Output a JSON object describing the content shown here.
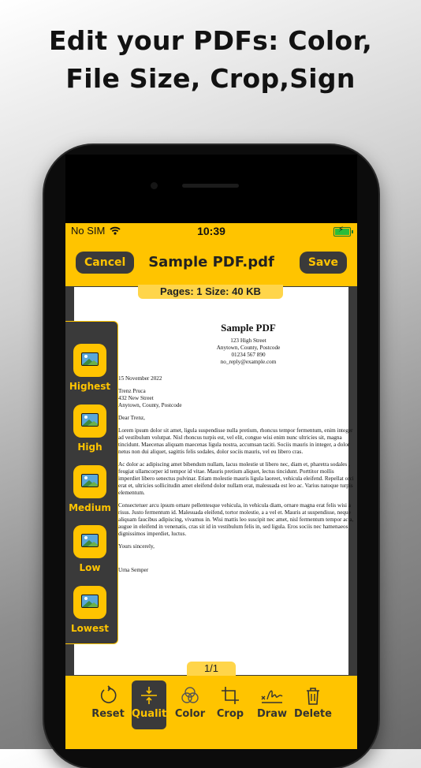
{
  "headline": {
    "line1": "Edit your PDFs: Color,",
    "line2": "File Size, Crop,Sign"
  },
  "status_bar": {
    "carrier": "No SIM",
    "time": "10:39"
  },
  "nav": {
    "cancel": "Cancel",
    "title": "Sample PDF.pdf",
    "save": "Save"
  },
  "doc_info": "Pages: 1   Size: 40 KB",
  "pdf": {
    "title": "Sample PDF",
    "address_lines": [
      "123 High Street",
      "Anytown, County, Postcode",
      "01234 567 890",
      "no_reply@example.com"
    ],
    "date": "15 November 2022",
    "recipient": [
      "Trenz Pruca",
      "432 New Street",
      "Anytown, County, Postcode"
    ],
    "salutation": "Dear Trenz,",
    "paragraphs": [
      "Lorem ipsum dolor sit amet, ligula suspendisse nulla pretium, rhoncus tempor fermentum, enim integer ad vestibulum volutpat. Nisl rhoncus turpis est, vel elit, congue wisi enim nunc ultricies sit, magna tincidunt. Maecenas aliquam maecenas ligula nostra, accumsan taciti. Sociis mauris in integer, a dolor netus non dui aliquet, sagittis felis sodales, dolor sociis mauris, vel eu libero cras.",
      "Ac dolor ac adipiscing amet bibendum nullam, lacus molestie ut libero nec, diam et, pharetra sodales , feugiat ullamcorper id tempor id vitae. Mauris pretium aliquet, lectus tincidunt. Porttitor mollis imperdiet libero senectus pulvinar. Etiam molestie mauris ligula laoreet, vehicula eleifend. Repellat orci erat et, ultricies sollicitudin amet eleifend dolor nullam erat, malesuada est leo ac. Varius natoque turpis elementum.",
      "Consectetuer arcu ipsum ornare pellentesque vehicula, in vehicula diam, ornare magna erat felis wisi a risus. Justo fermentum id. Malesuada eleifend, tortor molestie, a a vel et. Mauris at suspendisse, neque aliquam faucibus adipiscing, vivamus in. Wisi mattis leo suscipit nec amet, nisl fermentum tempor ac a, augue in eleifend in venenatis, cras sit id in vestibulum felis in, sed ligula. Eros sociis nec hamenaeos dignissimos imperdiet, luctus."
    ],
    "closing": "Yours sincerely,",
    "signature": "Urna Semper"
  },
  "quality_options": [
    {
      "label": "Highest",
      "icon": "image-icon"
    },
    {
      "label": "High",
      "icon": "image-icon"
    },
    {
      "label": "Medium",
      "icon": "image-icon"
    },
    {
      "label": "Low",
      "icon": "image-icon"
    },
    {
      "label": "Lowest",
      "icon": "image-icon"
    }
  ],
  "page_indicator": "1/1",
  "toolbar": [
    {
      "label": "Reset",
      "icon": "reset-icon",
      "active": false
    },
    {
      "label": "Quality",
      "icon": "quality-icon",
      "active": true
    },
    {
      "label": "Color",
      "icon": "color-icon",
      "active": false
    },
    {
      "label": "Crop",
      "icon": "crop-icon",
      "active": false
    },
    {
      "label": "Draw",
      "icon": "signature-icon",
      "active": false
    },
    {
      "label": "Delete",
      "icon": "trash-icon",
      "active": false
    }
  ],
  "colors": {
    "accent": "#ffc400",
    "dark": "#3a3a3a"
  }
}
